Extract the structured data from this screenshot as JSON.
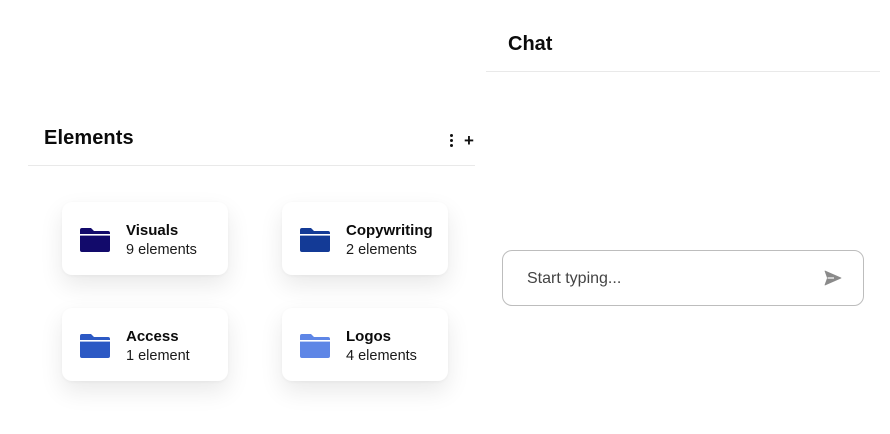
{
  "elements": {
    "title": "Elements",
    "icons": {
      "more": "more-vertical-icon",
      "add": "plus-icon"
    },
    "add_label": "+",
    "folders": [
      {
        "name": "Visuals",
        "count": "9 elements",
        "color": "#120a6b"
      },
      {
        "name": "Copywriting",
        "count": "2 elements",
        "color": "#133a96"
      },
      {
        "name": "Access",
        "count": "1 element",
        "color": "#2c59c4"
      },
      {
        "name": "Logos",
        "count": "4 elements",
        "color": "#5e86e6"
      }
    ]
  },
  "chat": {
    "title": "Chat",
    "input_placeholder": "Start typing...",
    "send_icon": "send-icon",
    "send_icon_color": "#8a8a8a"
  }
}
